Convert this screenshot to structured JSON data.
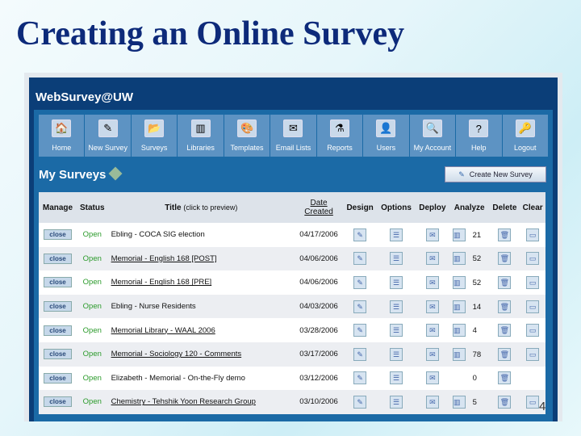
{
  "slide": {
    "title": "Creating an Online Survey",
    "page_number": "4"
  },
  "app": {
    "brand": "WebSurvey@UW"
  },
  "nav": [
    {
      "label": "Home",
      "icon": "home-icon",
      "glyph": "🏠"
    },
    {
      "label": "New Survey",
      "icon": "new-survey-icon",
      "glyph": "✎"
    },
    {
      "label": "Surveys",
      "icon": "folder-icon",
      "glyph": "📂"
    },
    {
      "label": "Libraries",
      "icon": "library-icon",
      "glyph": "▥"
    },
    {
      "label": "Templates",
      "icon": "palette-icon",
      "glyph": "🎨"
    },
    {
      "label": "Email Lists",
      "icon": "email-icon",
      "glyph": "✉"
    },
    {
      "label": "Reports",
      "icon": "reports-icon",
      "glyph": "⚗"
    },
    {
      "label": "Users",
      "icon": "user-icon",
      "glyph": "👤"
    },
    {
      "label": "My Account",
      "icon": "account-icon",
      "glyph": "🔍"
    },
    {
      "label": "Help",
      "icon": "help-icon",
      "glyph": "?"
    },
    {
      "label": "Logout",
      "icon": "key-icon",
      "glyph": "🔑"
    }
  ],
  "page": {
    "heading": "My Surveys",
    "create_button": "Create New Survey"
  },
  "table": {
    "headers": {
      "manage": "Manage",
      "status": "Status",
      "title": "Title",
      "title_hint": "(click to preview)",
      "date1": "Date",
      "date2": "Created",
      "design": "Design",
      "options": "Options",
      "deploy": "Deploy",
      "analyze": "Analyze",
      "delete": "Delete",
      "clear": "Clear"
    },
    "close_label": "close",
    "rows": [
      {
        "status": "Open",
        "title": "Ebling - COCA SIG election",
        "link": false,
        "date": "04/17/2006",
        "responses": "21",
        "clear": true,
        "analyze": true
      },
      {
        "status": "Open",
        "title": "Memorial - English 168 [POST]",
        "link": true,
        "date": "04/06/2006",
        "responses": "52",
        "clear": true,
        "analyze": true
      },
      {
        "status": "Open",
        "title": "Memorial - English 168 [PRE]",
        "link": true,
        "date": "04/06/2006",
        "responses": "52",
        "clear": true,
        "analyze": true
      },
      {
        "status": "Open",
        "title": "Ebling - Nurse Residents",
        "link": false,
        "date": "04/03/2006",
        "responses": "14",
        "clear": true,
        "analyze": true
      },
      {
        "status": "Open",
        "title": "Memorial Library - WAAL 2006",
        "link": true,
        "date": "03/28/2006",
        "responses": "4",
        "clear": true,
        "analyze": true
      },
      {
        "status": "Open",
        "title": "Memorial - Sociology 120 - Comments",
        "link": true,
        "date": "03/17/2006",
        "responses": "78",
        "clear": true,
        "analyze": true
      },
      {
        "status": "Open",
        "title": "Elizabeth - Memorial - On-the-Fly demo",
        "link": false,
        "date": "03/12/2006",
        "responses": "0",
        "clear": false,
        "analyze": false
      },
      {
        "status": "Open",
        "title": "Chemistry - Tehshik Yoon Research Group",
        "link": true,
        "date": "03/10/2006",
        "responses": "5",
        "clear": true,
        "analyze": true
      }
    ]
  }
}
